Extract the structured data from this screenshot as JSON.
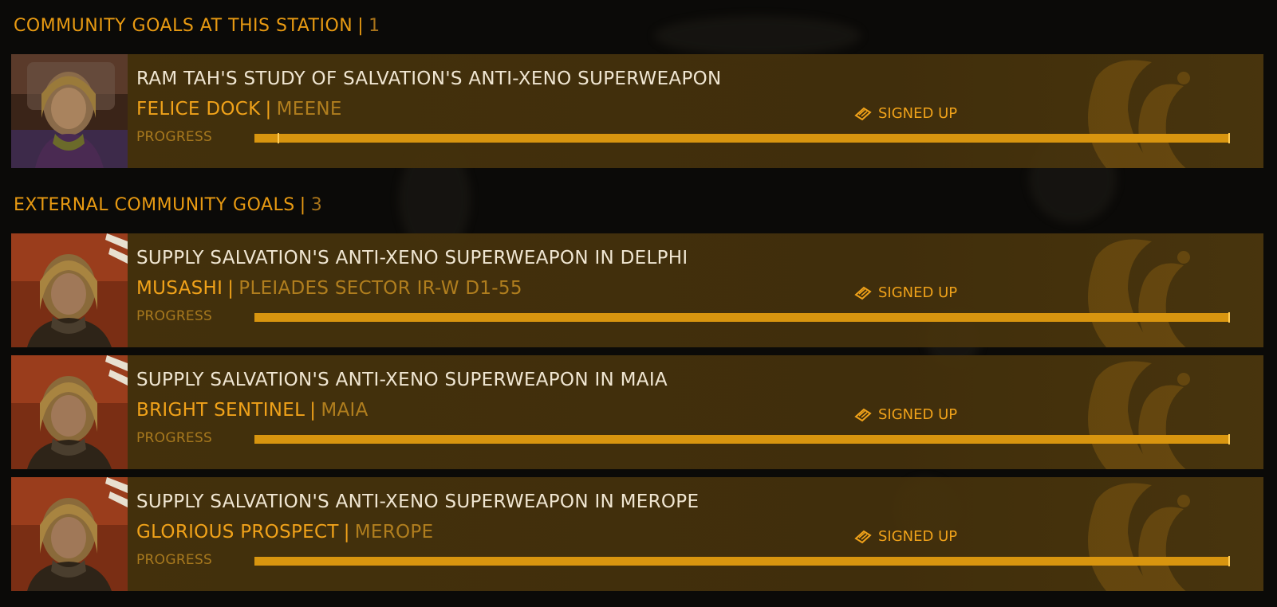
{
  "colors": {
    "accent": "#e89a12",
    "accent_dim": "#b07e1e",
    "title": "#f0e6d2",
    "card_bg": "#48340c"
  },
  "station_section": {
    "title": "COMMUNITY GOALS AT THIS STATION",
    "separator": "|",
    "count": "1"
  },
  "external_section": {
    "title": "EXTERNAL COMMUNITY GOALS",
    "separator": "|",
    "count": "3"
  },
  "goals": [
    {
      "title": "RAM TAH'S STUDY OF SALVATION'S ANTI-XENO SUPERWEAPON",
      "station": "FELICE DOCK",
      "separator": "|",
      "system": "MEENE",
      "status": "SIGNED UP",
      "status_icon": "signed-up-icon",
      "progress_label": "PROGRESS",
      "progress_fraction": 1.0,
      "progress_marker_fraction": 0.024,
      "portrait": "ram-tah-portrait"
    },
    {
      "title": "SUPPLY SALVATION'S ANTI-XENO SUPERWEAPON IN DELPHI",
      "station": "MUSASHI",
      "separator": "|",
      "system": "PLEIADES SECTOR IR-W D1-55",
      "status": "SIGNED UP",
      "status_icon": "signed-up-icon",
      "progress_label": "PROGRESS",
      "progress_fraction": 1.0,
      "portrait": "aegis-officer-portrait"
    },
    {
      "title": "SUPPLY SALVATION'S ANTI-XENO SUPERWEAPON IN MAIA",
      "station": "BRIGHT SENTINEL",
      "separator": "|",
      "system": "MAIA",
      "status": "SIGNED UP",
      "status_icon": "signed-up-icon",
      "progress_label": "PROGRESS",
      "progress_fraction": 1.0,
      "portrait": "aegis-officer-portrait"
    },
    {
      "title": "SUPPLY SALVATION'S ANTI-XENO SUPERWEAPON IN MEROPE",
      "station": "GLORIOUS PROSPECT",
      "separator": "|",
      "system": "MEROPE",
      "status": "SIGNED UP",
      "status_icon": "signed-up-icon",
      "progress_label": "PROGRESS",
      "progress_fraction": 1.0,
      "portrait": "aegis-officer-portrait"
    }
  ]
}
